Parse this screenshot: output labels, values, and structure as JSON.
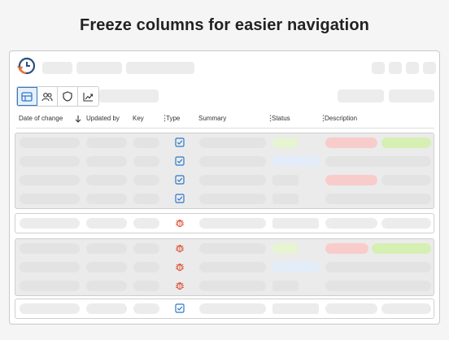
{
  "headline": "Freeze columns for easier navigation",
  "columns": [
    {
      "key": "date",
      "label": "Date of change",
      "sort": "descending"
    },
    {
      "key": "updated_by",
      "label": "Updated by"
    },
    {
      "key": "key",
      "label": "Key"
    },
    {
      "key": "type",
      "label": "Type"
    },
    {
      "key": "summary",
      "label": "Summary"
    },
    {
      "key": "status",
      "label": "Status"
    },
    {
      "key": "description",
      "label": "Description"
    }
  ],
  "view_buttons": [
    {
      "name": "table-view",
      "icon": "table-icon",
      "active": true
    },
    {
      "name": "users-view",
      "icon": "users-icon",
      "active": false
    },
    {
      "name": "security-view",
      "icon": "shield-icon",
      "active": false
    },
    {
      "name": "chart-view",
      "icon": "trend-chart-icon",
      "active": false
    }
  ],
  "groups": [
    {
      "frozen": true,
      "rows": [
        {
          "type": "task",
          "status": "green",
          "desc": [
            "red",
            "green"
          ]
        },
        {
          "type": "task",
          "status": "blue",
          "desc": [
            "grey"
          ]
        },
        {
          "type": "task",
          "status": "grey",
          "desc": [
            "red",
            "grey"
          ]
        },
        {
          "type": "task",
          "status": "grey-sm",
          "desc": [
            "grey"
          ]
        }
      ]
    },
    {
      "frozen": false,
      "rows": [
        {
          "type": "bug",
          "status": "blue",
          "desc": [
            "red",
            "green"
          ]
        }
      ]
    },
    {
      "frozen": true,
      "rows": [
        {
          "type": "bug",
          "status": "lgreen",
          "desc": [
            "red-sm",
            "green-wide"
          ]
        },
        {
          "type": "bug",
          "status": "blue",
          "desc": [
            "grey"
          ]
        },
        {
          "type": "bug",
          "status": "grey-sm",
          "desc": [
            "grey"
          ]
        }
      ]
    },
    {
      "frozen": false,
      "rows": [
        {
          "type": "task",
          "status": "blue",
          "desc": [
            "red",
            "green"
          ]
        }
      ]
    }
  ],
  "colors": {
    "accent": "#2f77c9",
    "bug": "#e0543e",
    "task": "#2f77c9"
  }
}
